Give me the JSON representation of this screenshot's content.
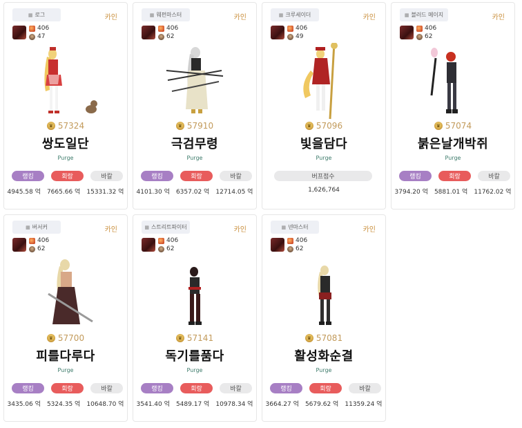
{
  "cards": [
    {
      "class": "로그",
      "server": "카인",
      "level": "406",
      "sub": "47",
      "fame": "57324",
      "name": "쌍도일단",
      "guild": "Purge",
      "rank_label": "랭킹",
      "heal_label": "회랑",
      "bar_label": "바칼",
      "v1": "4945.58 억",
      "v2": "7665.66 억",
      "v3": "15331.32 억"
    },
    {
      "class": "웨펀마스터",
      "server": "카인",
      "level": "406",
      "sub": "62",
      "fame": "57910",
      "name": "극검무령",
      "guild": "Purge",
      "rank_label": "랭킹",
      "heal_label": "회랑",
      "bar_label": "바칼",
      "v1": "4101.30 억",
      "v2": "6357.02 억",
      "v3": "12714.05 억"
    },
    {
      "class": "크루세이더",
      "server": "카인",
      "level": "406",
      "sub": "49",
      "fame": "57096",
      "name": "빛을담다",
      "guild": "Purge",
      "buff_label": "버프점수",
      "buff_value": "1,626,764"
    },
    {
      "class": "블러드 메이지",
      "server": "카인",
      "level": "406",
      "sub": "62",
      "fame": "57074",
      "name": "붉은날개박쥐",
      "guild": "Purge",
      "rank_label": "랭킹",
      "heal_label": "회랑",
      "bar_label": "바칼",
      "v1": "3794.20 억",
      "v2": "5881.01 억",
      "v3": "11762.02 억"
    },
    {
      "class": "버서커",
      "server": "카인",
      "level": "406",
      "sub": "62",
      "fame": "57700",
      "name": "피를다루다",
      "guild": "Purge",
      "rank_label": "랭킹",
      "heal_label": "회랑",
      "bar_label": "바칼",
      "v1": "3435.06 억",
      "v2": "5324.35 억",
      "v3": "10648.70 억"
    },
    {
      "class": "스트리트파이터",
      "server": "카인",
      "level": "406",
      "sub": "62",
      "fame": "57141",
      "name": "독기를품다",
      "guild": "Purge",
      "rank_label": "랭킹",
      "heal_label": "회랑",
      "bar_label": "바칼",
      "v1": "3541.40 억",
      "v2": "5489.17 억",
      "v3": "10978.34 억"
    },
    {
      "class": "넨마스터",
      "server": "카인",
      "level": "406",
      "sub": "62",
      "fame": "57081",
      "name": "활성화순결",
      "guild": "Purge",
      "rank_label": "랭킹",
      "heal_label": "회랑",
      "bar_label": "바칼",
      "v1": "3664.27 억",
      "v2": "5679.62 억",
      "v3": "11359.24 억"
    }
  ],
  "colors": {
    "rank": "#a77fc4",
    "heal": "#e85c5c",
    "bar": "#e9e9ea",
    "fame": "#c29a5a",
    "guild": "#3c7a6a",
    "server": "#c98f3c"
  }
}
